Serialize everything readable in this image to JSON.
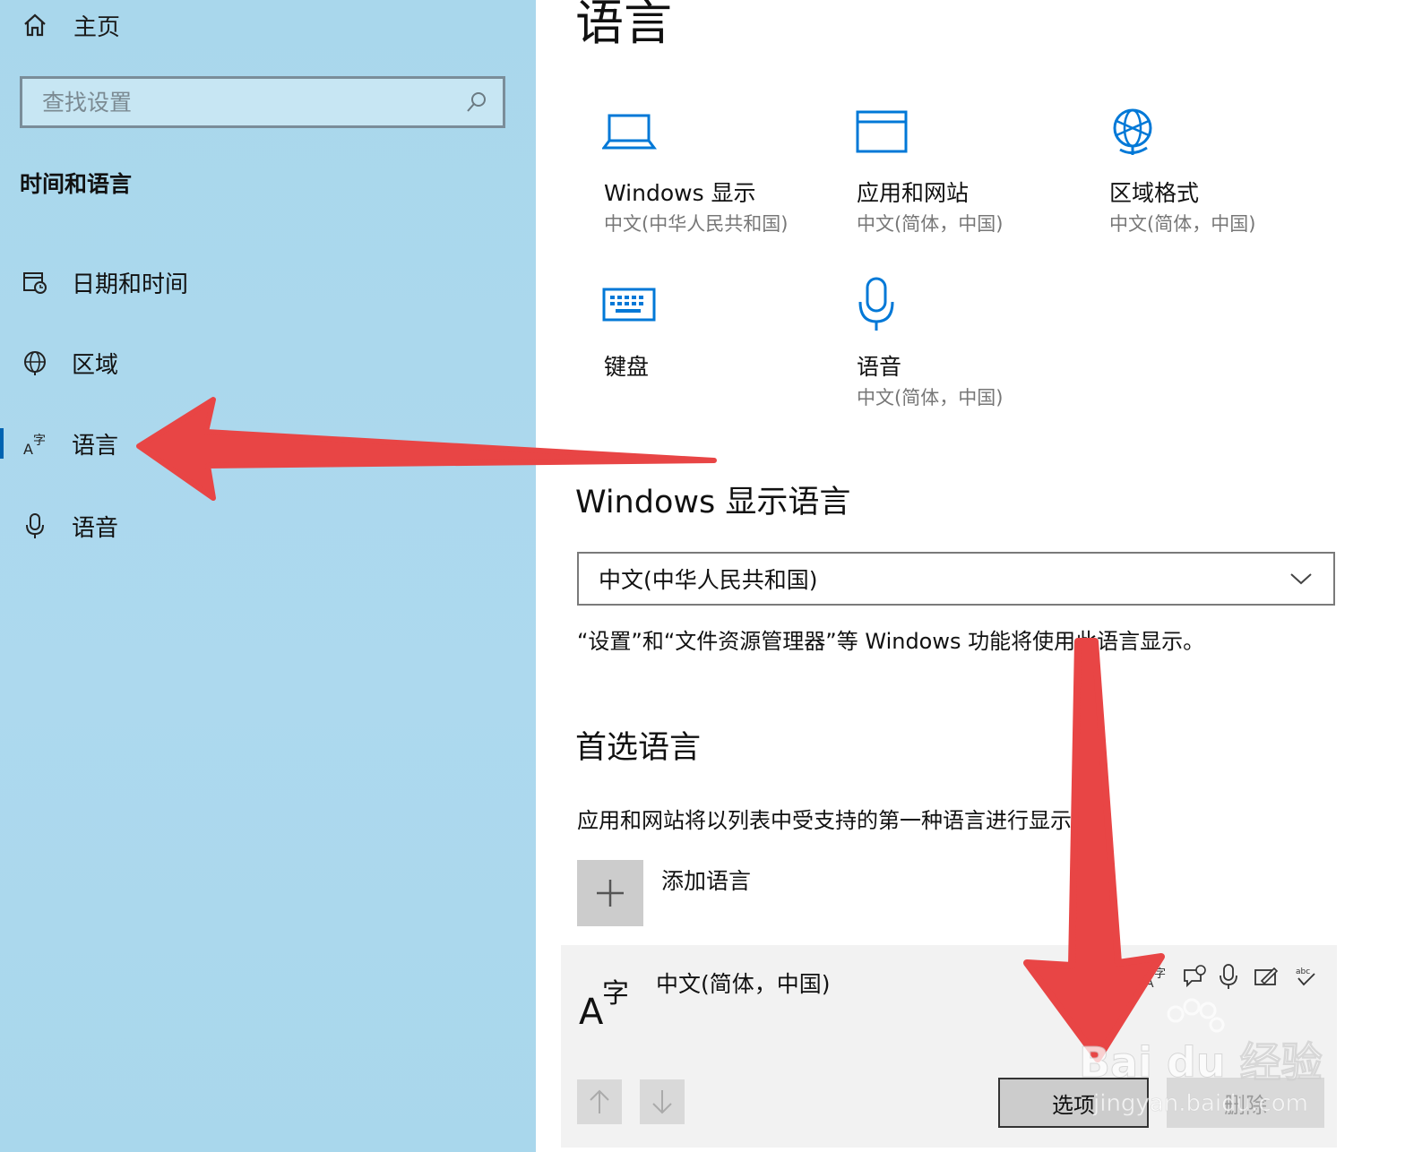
{
  "sidebar": {
    "home_label": "主页",
    "search_placeholder": "查找设置",
    "section_title": "时间和语言",
    "items": [
      {
        "label": "日期和时间",
        "icon": "calendar-clock-icon"
      },
      {
        "label": "区域",
        "icon": "globe-icon"
      },
      {
        "label": "语言",
        "icon": "language-icon"
      },
      {
        "label": "语音",
        "icon": "microphone-icon"
      }
    ],
    "active_index": 2
  },
  "main": {
    "title": "语言",
    "related": [
      {
        "name": "Windows 显示",
        "sub": "中文(中华人民共和国)",
        "icon": "laptop-icon"
      },
      {
        "name": "应用和网站",
        "sub": "中文(简体，中国)",
        "icon": "window-icon"
      },
      {
        "name": "区域格式",
        "sub": "中文(简体，中国)",
        "icon": "globe-icon"
      },
      {
        "name": "键盘",
        "sub": "",
        "icon": "keyboard-icon"
      },
      {
        "name": "语音",
        "sub": "中文(简体，中国)",
        "icon": "microphone-icon"
      }
    ],
    "display_language": {
      "heading": "Windows 显示语言",
      "selected": "中文(中华人民共和国)",
      "description": "“设置”和“文件资源管理器”等 Windows 功能将使用此语言显示。"
    },
    "preferred": {
      "heading": "首选语言",
      "description": "应用和网站将以列表中受支持的第一种语言进行显示。",
      "add_label": "添加语言",
      "language_name": "中文(简体，中国)",
      "language_icon_text": "A字",
      "options_label": "选项",
      "remove_label": "删除"
    }
  },
  "watermark": {
    "brand": "Bai du 经验",
    "url": "jingyan.baidu.com"
  },
  "colors": {
    "sidebar_bg": "#abd8ed",
    "accent": "#0078d7",
    "annotation_arrow": "#e84545"
  }
}
